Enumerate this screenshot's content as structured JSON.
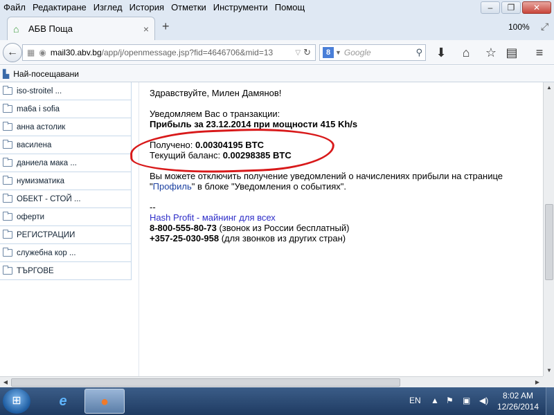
{
  "menu": [
    "Файл",
    "Редактиране",
    "Изглед",
    "История",
    "Отметки",
    "Инструменти",
    "Помощ"
  ],
  "window_controls": {
    "minimize": "–",
    "restore": "❐",
    "close": "✕"
  },
  "tab": {
    "title": "АБВ Поща",
    "close": "×"
  },
  "new_tab": "+",
  "zoom": "100%",
  "url": {
    "host": "mail30.abv.bg",
    "path": "/app/j/openmessage.jsp?fid=4646706&mid=13"
  },
  "search": {
    "engine_letter": "8",
    "placeholder": "Google"
  },
  "bookmarks": {
    "label": "Най-посещавани"
  },
  "folders": [
    "iso-stroitel ...",
    "ma6a i sofia",
    "анна астолик",
    "василена",
    "даниела мака ...",
    "нумизматика",
    "ОБЕКТ - СТОЙ ...",
    "оферти",
    "РЕГИСТРАЦИИ",
    "служебна кор ...",
    "ТЪРГОВЕ"
  ],
  "message": {
    "greeting": "Здравствуйте, Милен Дамянов!",
    "notify": "Уведомляем Вас о транзакции:",
    "profit_line": "Прибыль за 23.12.2014 при мощности 415 Kh/s",
    "received_label": "Получено: ",
    "received_value": "0.00304195 BTC",
    "balance_label": "Текущий баланс: ",
    "balance_value": "0.00298385 BTC",
    "disable_text": "Вы можете отключить получение уведомлений о начислениях прибыли на странице",
    "profile_open": "\"",
    "profile_link": "Профиль",
    "profile_rest": "\" в блоке \"Уведомления о событиях\".",
    "sig_dash": "--",
    "sig_name": "Hash Profit",
    "sig_tagline": " - майнинг для всех",
    "phone1": "8-800-555-80-73",
    "phone1_note": " (звонок из России бесплатный)",
    "phone2": "+357-25-030-958",
    "phone2_note": " (для звонков из других стран)"
  },
  "taskbar": {
    "lang": "EN",
    "time": "8:02 AM",
    "date": "12/26/2014"
  }
}
